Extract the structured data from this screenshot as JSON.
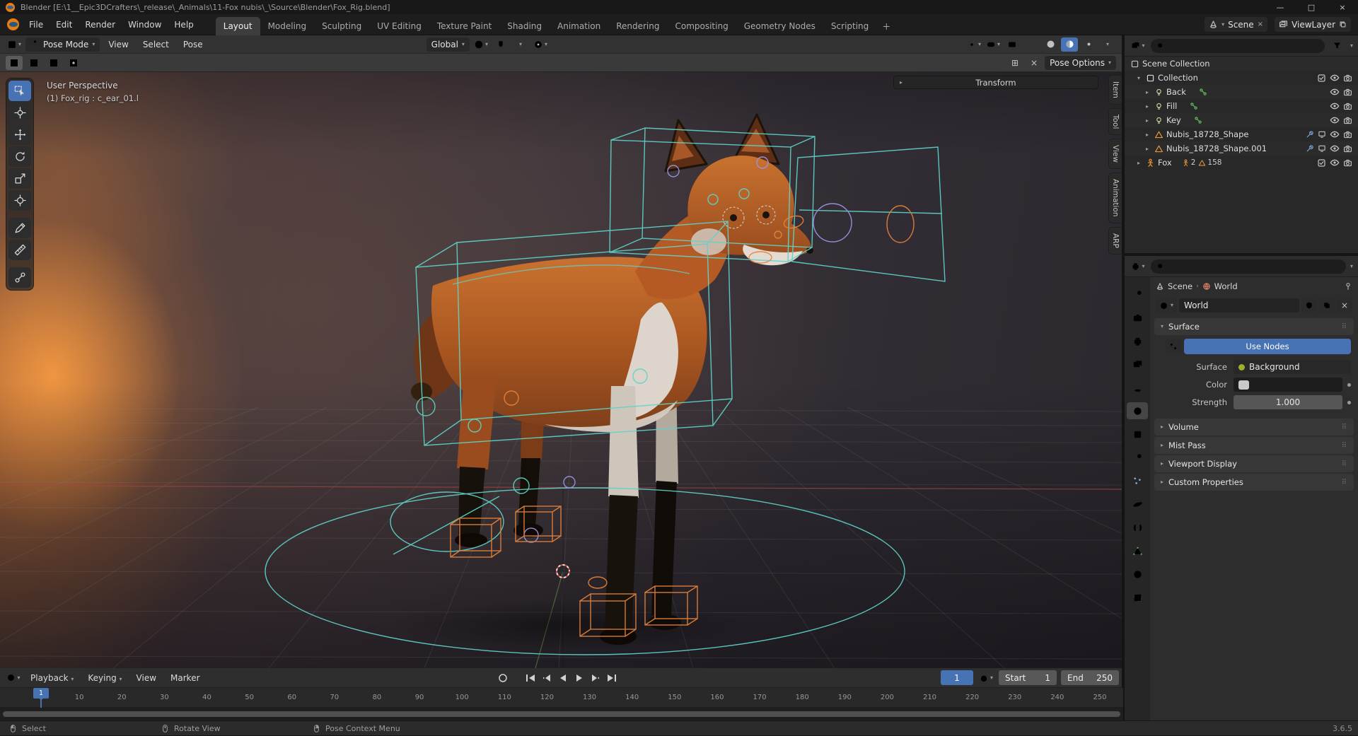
{
  "window": {
    "title": "Blender [E:\\1__Epic3DCrafters\\_release\\_Animals\\11-Fox nubis\\_\\Source\\Blender\\Fox_Rig.blend]",
    "minimize": "—",
    "maximize": "□",
    "close": "×"
  },
  "icons": {
    "caret": "▾",
    "caret_right": "▸",
    "close": "×",
    "plus": "＋",
    "grid": "⊞",
    "dots": "⠿",
    "sep": "›"
  },
  "colors": {
    "accent": "#4772b3",
    "rig_cyan": "#5fd3c9",
    "rig_orange": "#e8833a",
    "fox_orange": "#b55a24"
  },
  "topbar": {
    "menus": [
      "File",
      "Edit",
      "Render",
      "Window",
      "Help"
    ],
    "workspaces": [
      "Layout",
      "Modeling",
      "Sculpting",
      "UV Editing",
      "Texture Paint",
      "Shading",
      "Animation",
      "Rendering",
      "Compositing",
      "Geometry Nodes",
      "Scripting"
    ],
    "scene": "Scene",
    "viewlayer": "ViewLayer"
  },
  "viewport": {
    "mode": "Pose Mode",
    "menus": [
      "View",
      "Select",
      "Pose"
    ],
    "orientation": "Global",
    "pose_options": "Pose Options",
    "overlay_perspective": "User Perspective",
    "overlay_active": "(1) Fox_rig : c_ear_01.l",
    "transform_panel": "Transform",
    "sidebar_tabs": [
      "Item",
      "Tool",
      "View",
      "Animation",
      "ARP"
    ]
  },
  "outliner": {
    "root": "Scene Collection",
    "collection": "Collection",
    "children": [
      "Back",
      "Fill",
      "Key",
      "Nubis_18728_Shape",
      "Nubis_18728_Shape.001"
    ],
    "fox": "Fox",
    "fox_badges": [
      "2",
      "158"
    ]
  },
  "properties": {
    "breadcrumb_scene": "Scene",
    "breadcrumb_world": "World",
    "datablock": "World",
    "surface_header": "Surface",
    "use_nodes": "Use Nodes",
    "surface_label": "Surface",
    "surface_value": "Background",
    "color_label": "Color",
    "strength_label": "Strength",
    "strength_value": "1.000",
    "collapsed": [
      "Volume",
      "Mist Pass",
      "Viewport Display",
      "Custom Properties"
    ]
  },
  "timeline": {
    "menus": [
      "Playback",
      "Keying",
      "View",
      "Marker"
    ],
    "frame": "1",
    "start_label": "Start",
    "start_value": "1",
    "end_label": "End",
    "end_value": "250",
    "ticks": [
      1,
      10,
      20,
      30,
      40,
      50,
      60,
      70,
      80,
      90,
      100,
      110,
      120,
      130,
      140,
      150,
      160,
      170,
      180,
      190,
      200,
      210,
      220,
      230,
      240,
      250
    ]
  },
  "status": {
    "hints": [
      "Select",
      "Rotate View",
      "Pose Context Menu"
    ],
    "version": "3.6.5"
  }
}
